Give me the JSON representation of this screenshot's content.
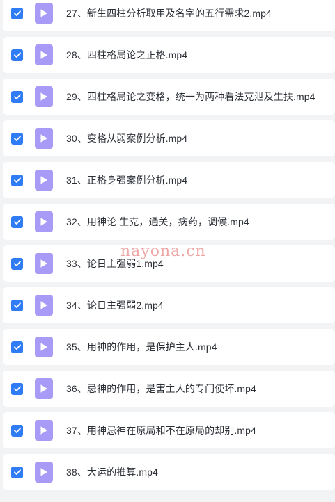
{
  "files": [
    {
      "name": "27、新生四柱分析取用及名字的五行需求2.mp4",
      "checked": true
    },
    {
      "name": "28、四柱格局论之正格.mp4",
      "checked": true
    },
    {
      "name": "29、四柱格局论之变格，统一为两种看法克泄及生扶.mp4",
      "checked": true
    },
    {
      "name": "30、变格从弱案例分析.mp4",
      "checked": true
    },
    {
      "name": "31、正格身强案例分析.mp4",
      "checked": true
    },
    {
      "name": "32、用神论 生克，通关，病药，调候.mp4",
      "checked": true
    },
    {
      "name": "33、论日主强弱1.mp4",
      "checked": true
    },
    {
      "name": "34、论日主强弱2.mp4",
      "checked": true
    },
    {
      "name": "35、用神的作用，是保护主人.mp4",
      "checked": true
    },
    {
      "name": "36、忌神的作用，是害主人的专门使坏.mp4",
      "checked": true
    },
    {
      "name": "37、用神忌神在原局和不在原局的却别.mp4",
      "checked": true
    },
    {
      "name": "38、大运的推算.mp4",
      "checked": true
    }
  ],
  "watermark": "nayona.cn",
  "icons": {
    "checkbox": "checkmark-icon",
    "file": "video-play-icon"
  },
  "colors": {
    "checkbox": "#2f7cf6",
    "file_icon": "#a79bf7",
    "text": "#2b2f36",
    "background": "#f2f3f5"
  }
}
